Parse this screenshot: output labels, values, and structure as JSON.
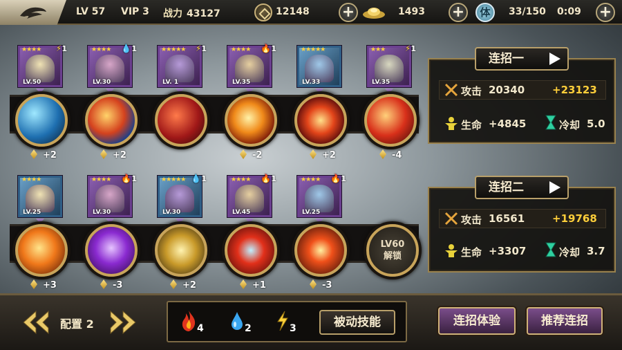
{
  "header": {
    "level_label": "LV 57",
    "vip_label": "VIP 3",
    "power_label": "战力",
    "power_value": "43127",
    "coins": "12148",
    "ingots": "1493",
    "stamina_icon_text": "体",
    "stamina": "33/150",
    "timer": "0:09"
  },
  "rows": [
    {
      "slots": [
        {
          "stars": "★★★★",
          "lv": "LV.50",
          "elem": "lightning",
          "elem_count": "1",
          "diff": "+2",
          "skill": "blue-slash"
        },
        {
          "stars": "★★★★",
          "lv": "LV.30",
          "elem": "water",
          "elem_count": "1",
          "diff": "+2",
          "skill": "blue-fire"
        },
        {
          "stars": "★★★★★",
          "lv": "LV. 1",
          "elem": "lightning",
          "elem_count": "1",
          "diff": "",
          "skill": "red-claw"
        },
        {
          "stars": "★★★★",
          "lv": "LV.35",
          "elem": "fire",
          "elem_count": "1",
          "diff": "-2",
          "skill": "flame-blade"
        },
        {
          "stars": "★★★★★",
          "lv": "LV.33",
          "elem": "",
          "elem_count": "",
          "diff": "+2",
          "skill": "red-vortex"
        },
        {
          "stars": "★★★",
          "lv": "LV.35",
          "elem": "lightning",
          "elem_count": "1",
          "diff": "-4",
          "skill": "fire-swirl"
        }
      ]
    },
    {
      "slots": [
        {
          "stars": "★★★★",
          "lv": "LV.25",
          "elem": "",
          "elem_count": "",
          "diff": "+3",
          "skill": "fire-slash"
        },
        {
          "stars": "★★★★",
          "lv": "LV.30",
          "elem": "fire",
          "elem_count": "1",
          "diff": "-3",
          "skill": "purple-sword"
        },
        {
          "stars": "★★★★★",
          "lv": "LV.30",
          "elem": "water",
          "elem_count": "1",
          "diff": "+2",
          "skill": "gold-blades"
        },
        {
          "stars": "★★★★",
          "lv": "LV.45",
          "elem": "fire",
          "elem_count": "1",
          "diff": "+1",
          "skill": "red-spear"
        },
        {
          "stars": "★★★★",
          "lv": "LV.25",
          "elem": "fire",
          "elem_count": "1",
          "diff": "-3",
          "skill": "explosion"
        }
      ],
      "locked": {
        "line1": "LV60",
        "line2": "解锁"
      }
    }
  ],
  "panels": [
    {
      "title": "连招一",
      "attack_label": "攻击",
      "attack": "20340",
      "attack_bonus": "+23123",
      "hp_label": "生命",
      "hp": "+4845",
      "cd_label": "冷却",
      "cd": "5.0"
    },
    {
      "title": "连招二",
      "attack_label": "攻击",
      "attack": "16561",
      "attack_bonus": "+19768",
      "hp_label": "生命",
      "hp": "+3307",
      "cd_label": "冷却",
      "cd": "3.7"
    }
  ],
  "bottom": {
    "config_label": "配置 2",
    "fire_count": "4",
    "water_count": "2",
    "lightning_count": "3",
    "passive_btn": "被动技能",
    "trial_btn": "连招体验",
    "recommend_btn": "推荐连招"
  },
  "colors": {
    "accent_gold": "#ffcf3a",
    "frame": "#9a824d",
    "purple": "#7a4d8a"
  }
}
